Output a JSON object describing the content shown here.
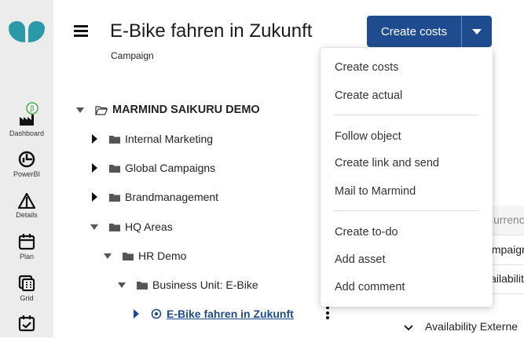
{
  "sidebar": {
    "items": [
      {
        "label": "Dashboard",
        "icon": "dashboard-icon"
      },
      {
        "label": "PowerBI",
        "icon": "powerbi-icon"
      },
      {
        "label": "Details",
        "icon": "details-icon"
      },
      {
        "label": "Plan",
        "icon": "plan-icon"
      },
      {
        "label": "Grid",
        "icon": "grid-icon"
      },
      {
        "label": "",
        "icon": "calendar-check-icon"
      }
    ],
    "beta_badge": "β"
  },
  "header": {
    "title": "E-Bike fahren in Zukunft",
    "subtitle": "Campaign",
    "create_button": "Create costs"
  },
  "tree": {
    "root": "MARMIND SAIKURU DEMO",
    "items": [
      {
        "label": "Internal Marketing"
      },
      {
        "label": "Global Campaigns"
      },
      {
        "label": "Brandmanagement"
      },
      {
        "label": "HQ Areas"
      },
      {
        "label": "HR Demo"
      },
      {
        "label": "Business Unit: E-Bike"
      },
      {
        "label": "E-Bike fahren in Zukunft"
      }
    ]
  },
  "table": {
    "header": "Currency",
    "rows": [
      "Campaign",
      "Availability Camp",
      "Availability Externe"
    ]
  },
  "menu": {
    "items": [
      "Create costs",
      "Create actual",
      "Follow object",
      "Create link and send",
      "Mail to Marmind",
      "Create to-do",
      "Add asset",
      "Add comment"
    ]
  },
  "colors": {
    "accent": "#1f4c8f",
    "logo": "#2a9aa8",
    "rail": "#ececec"
  }
}
